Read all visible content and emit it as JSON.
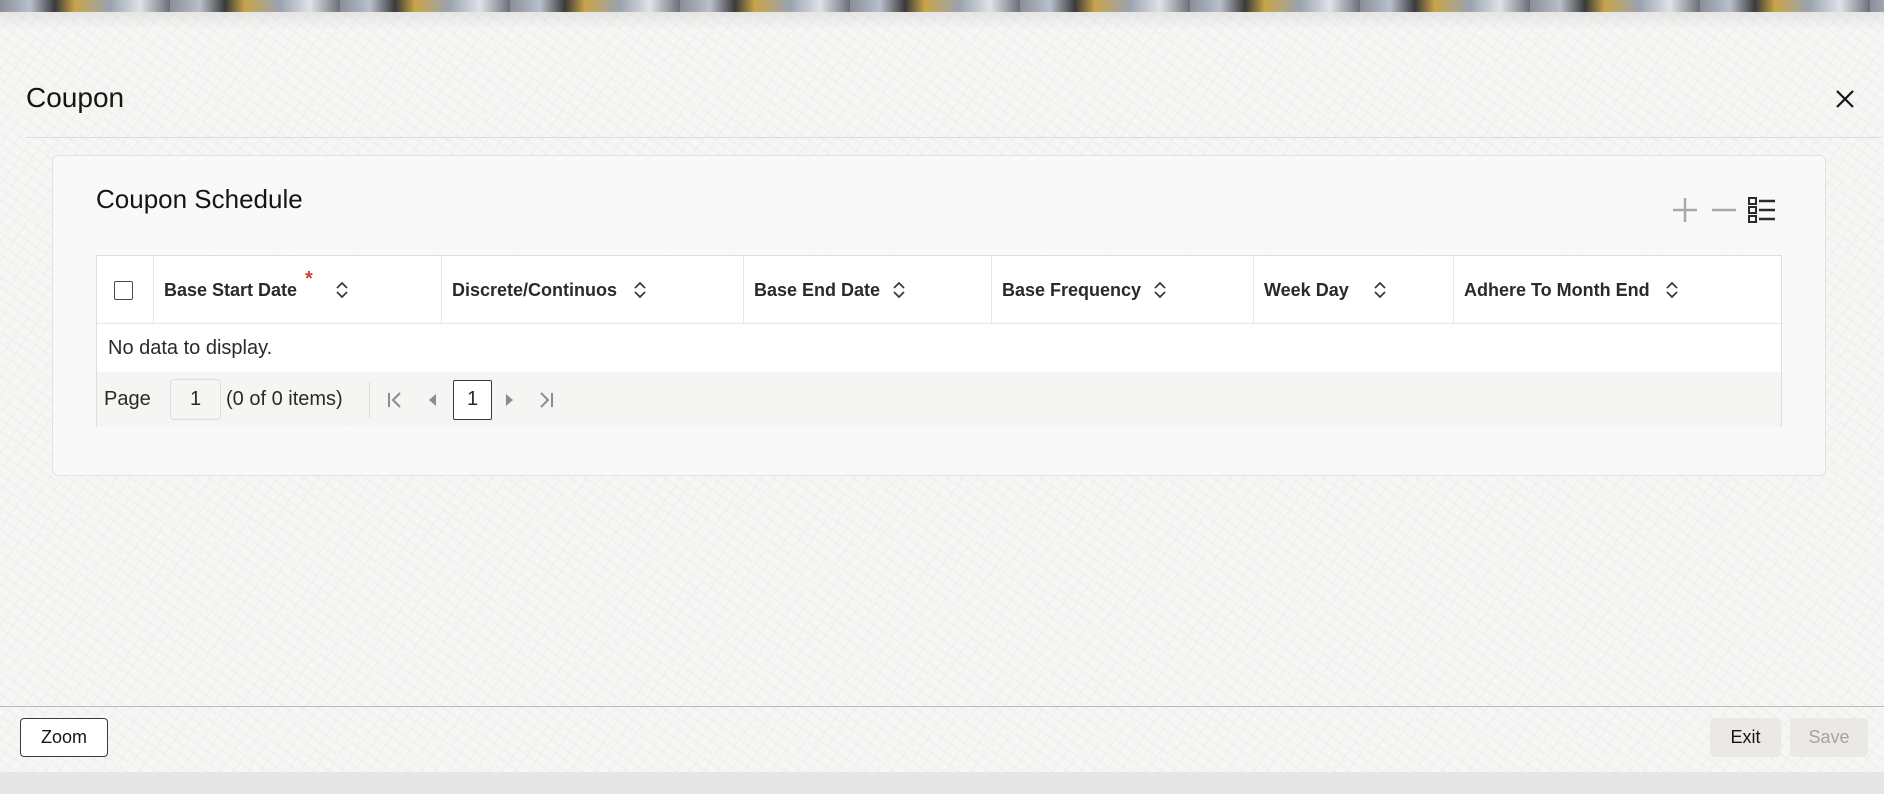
{
  "dialog": {
    "title": "Coupon"
  },
  "panel": {
    "title": "Coupon Schedule"
  },
  "grid": {
    "columns": [
      {
        "label": "Base Start Date",
        "required": true
      },
      {
        "label": "Discrete/Continuos"
      },
      {
        "label": "Base End Date"
      },
      {
        "label": "Base Frequency"
      },
      {
        "label": "Week Day"
      },
      {
        "label": "Adhere To Month End"
      }
    ],
    "empty_message": "No data to display."
  },
  "pager": {
    "page_label": "Page",
    "page_input": "1",
    "count_text": "(0 of 0 items)",
    "current_page": "1"
  },
  "footer": {
    "zoom_label": "Zoom",
    "exit_label": "Exit",
    "save_label": "Save"
  },
  "required_marker": "*",
  "colors": {
    "required": "#c74634",
    "disabled_text": "#a6a39f",
    "button_bg": "#ebe9e6"
  }
}
